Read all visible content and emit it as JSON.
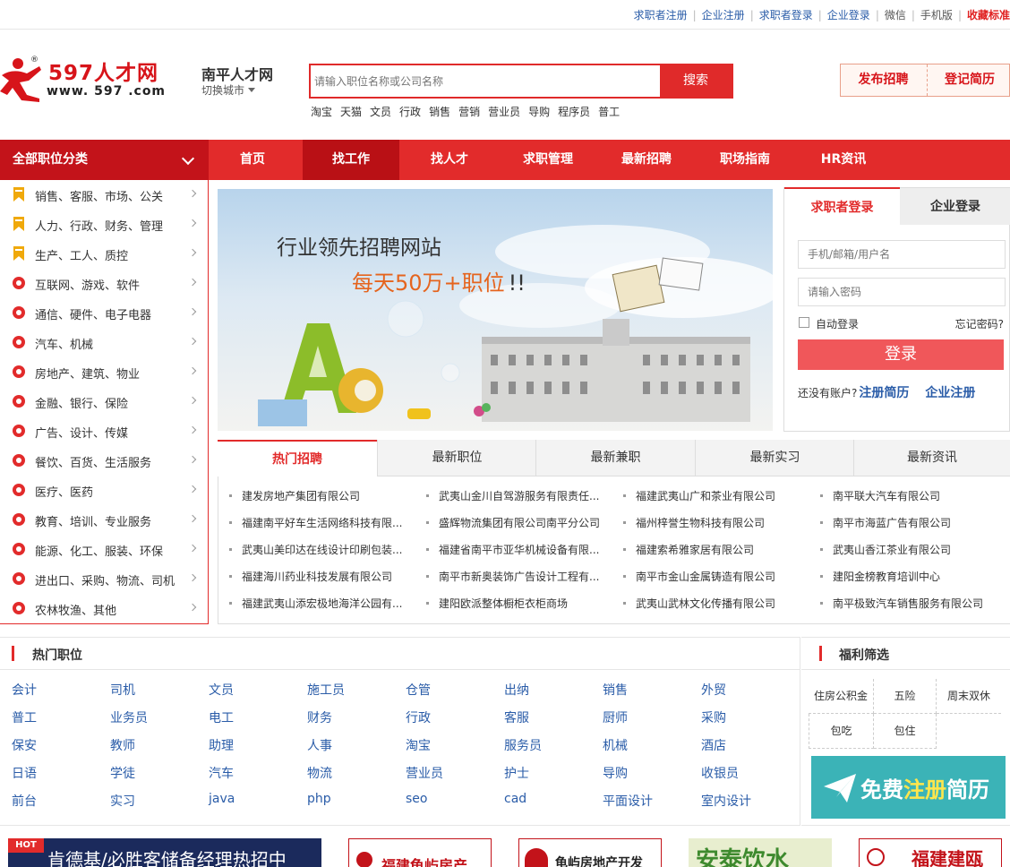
{
  "topbar": {
    "links": [
      {
        "label": "求职者注册",
        "style": "blue"
      },
      {
        "label": "企业注册",
        "style": "blue"
      },
      {
        "label": "求职者登录",
        "style": "blue"
      },
      {
        "label": "企业登录",
        "style": "blue"
      },
      {
        "label": "微信",
        "style": "gray"
      },
      {
        "label": "手机版",
        "style": "gray"
      },
      {
        "label": "收藏标准",
        "style": "red"
      }
    ]
  },
  "logo": {
    "cn": "597人才网",
    "url_text": "www. 597 .com",
    "reg": "®"
  },
  "city": {
    "name": "南平人才网",
    "switch_label": "切换城市"
  },
  "search": {
    "placeholder": "请输入职位名称或公司名称",
    "button": "搜索",
    "hotwords": [
      "淘宝",
      "天猫",
      "文员",
      "行政",
      "销售",
      "营销",
      "营业员",
      "导购",
      "程序员",
      "普工"
    ]
  },
  "header_buttons": {
    "post_job": "发布招聘",
    "register_resume": "登记简历"
  },
  "nav": {
    "all_categories": "全部职位分类",
    "items": [
      "首页",
      "找工作",
      "找人才",
      "求职管理",
      "最新招聘",
      "职场指南",
      "HR资讯"
    ],
    "active_index": 1
  },
  "categories": [
    {
      "label": "销售、客服、市场、公关",
      "icon": "bookmark-icon"
    },
    {
      "label": "人力、行政、财务、管理",
      "icon": "bookmark-icon"
    },
    {
      "label": "生产、工人、质控",
      "icon": "bookmark-icon"
    },
    {
      "label": "互联网、游戏、软件",
      "icon": "at-icon"
    },
    {
      "label": "通信、硬件、电子电器",
      "icon": "signal-icon"
    },
    {
      "label": "汽车、机械",
      "icon": "car-icon"
    },
    {
      "label": "房地产、建筑、物业",
      "icon": "building-icon"
    },
    {
      "label": "金融、银行、保险",
      "icon": "yen-icon"
    },
    {
      "label": "广告、设计、传媒",
      "icon": "video-icon"
    },
    {
      "label": "餐饮、百货、生活服务",
      "icon": "shop-icon"
    },
    {
      "label": "医疗、医药",
      "icon": "medical-icon"
    },
    {
      "label": "教育、培训、专业服务",
      "icon": "books-icon"
    },
    {
      "label": "能源、化工、服装、环保",
      "icon": "flask-icon"
    },
    {
      "label": "进出口、采购、物流、司机",
      "icon": "truck-icon"
    },
    {
      "label": "农林牧渔、其他",
      "icon": "globe-icon"
    }
  ],
  "banner": {
    "line1": "行业领先招聘网站",
    "line2_a": "每天",
    "line2_b": "50万+",
    "line2_c": "职位",
    "line2_d": "!!"
  },
  "login": {
    "tab_seeker": "求职者登录",
    "tab_company": "企业登录",
    "username_placeholder": "手机/邮箱/用户名",
    "password_placeholder": "请输入密码",
    "auto_login": "自动登录",
    "forgot": "忘记密码?",
    "submit": "登录",
    "no_account": "还没有账户?",
    "register_resume": "注册简历",
    "register_company": "企业注册"
  },
  "hot_tabs": [
    "热门招聘",
    "最新职位",
    "最新兼职",
    "最新实习",
    "最新资讯"
  ],
  "companies": [
    [
      "建发房地产集团有限公司",
      "武夷山金川自驾游服务有限责任...",
      "福建武夷山广和茶业有限公司",
      "南平联大汽车有限公司"
    ],
    [
      "福建南平好车生活网络科技有限...",
      "盛辉物流集团有限公司南平分公司",
      "福州梓誉生物科技有限公司",
      "南平市海蓝广告有限公司"
    ],
    [
      "武夷山美印达在线设计印刷包装...",
      "福建省南平市亚华机械设备有限...",
      "福建索希雅家居有限公司",
      "武夷山香江茶业有限公司"
    ],
    [
      "福建海川药业科技发展有限公司",
      "南平市新奥装饰广告设计工程有...",
      "南平市金山金属铸造有限公司",
      "建阳金榜教育培训中心"
    ],
    [
      "福建武夷山添宏极地海洋公园有...",
      "建阳欧派整体橱柜衣柜商场",
      "武夷山武林文化传播有限公司",
      "南平极致汽车销售服务有限公司"
    ]
  ],
  "hot_jobs": {
    "title": "热门职位",
    "rows": [
      [
        "会计",
        "司机",
        "文员",
        "施工员",
        "仓管",
        "出纳",
        "销售",
        "外贸"
      ],
      [
        "普工",
        "业务员",
        "电工",
        "财务",
        "行政",
        "客服",
        "厨师",
        "采购"
      ],
      [
        "保安",
        "教师",
        "助理",
        "人事",
        "淘宝",
        "服务员",
        "机械",
        "酒店"
      ],
      [
        "日语",
        "学徒",
        "汽车",
        "物流",
        "营业员",
        "护士",
        "导购",
        "收银员"
      ],
      [
        "前台",
        "实习",
        "java",
        "php",
        "seo",
        "cad",
        "平面设计",
        "室内设计"
      ]
    ]
  },
  "welfare": {
    "title": "福利筛选",
    "items": [
      "住房公积金",
      "五险",
      "周末双休",
      "包吃",
      "包住"
    ],
    "reg_banner_a": "免费",
    "reg_banner_b": "注册",
    "reg_banner_c": "简历"
  },
  "ads": [
    {
      "text": "肯德基/必胜客储备经理热招中",
      "badge": "HOT"
    },
    {
      "text": "福建龟屿房产"
    },
    {
      "text": "龟屿房地产开发"
    },
    {
      "text": "安泰饮水"
    },
    {
      "text": "福建建瓯"
    }
  ],
  "colors": {
    "brand_red": "#e22b2b",
    "dark_red": "#c3131a",
    "link_blue": "#2a5ca8",
    "teal": "#3bb3b7"
  }
}
